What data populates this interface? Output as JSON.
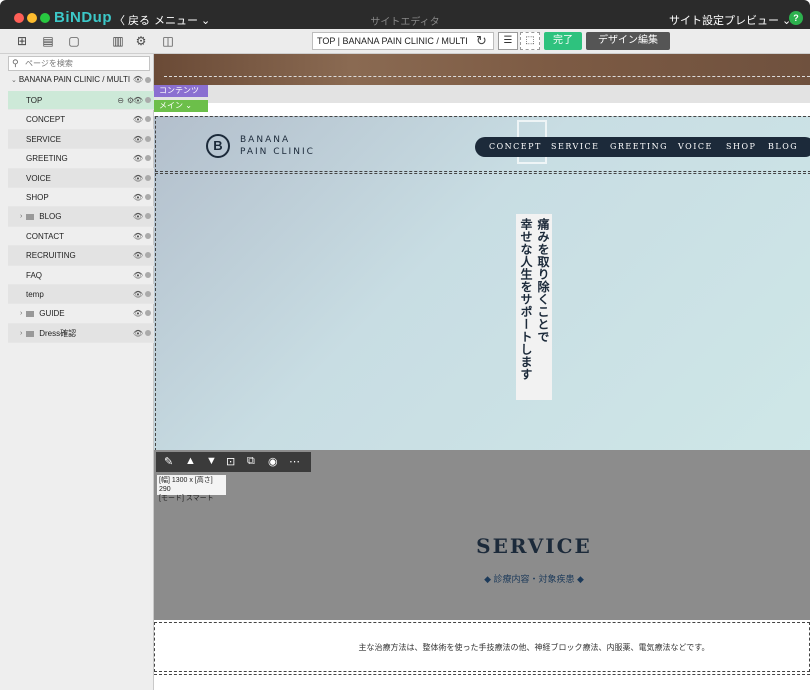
{
  "titlebar": {
    "logo": "BiNDup",
    "back": "〈 戻る",
    "menu": "メニュー ⌄",
    "title": "サイトエディタ",
    "site_settings": "サイト設定",
    "preview": "プレビュー ⌄",
    "help_icon": "help-icon"
  },
  "toolbar": {
    "url": "TOP | BANANA PAIN CLINIC / MULTI",
    "done_label": "完了",
    "design_label": "デザイン編集"
  },
  "sidebar": {
    "search_placeholder": "ページを検索",
    "root_label": "BANANA PAIN CLINIC / MULTI",
    "items": [
      {
        "label": "TOP"
      },
      {
        "label": "CONCEPT"
      },
      {
        "label": "SERVICE"
      },
      {
        "label": "GREETING"
      },
      {
        "label": "VOICE"
      },
      {
        "label": "SHOP"
      },
      {
        "label": "BLOG"
      },
      {
        "label": "CONTACT"
      },
      {
        "label": "RECRUITING"
      },
      {
        "label": "FAQ"
      },
      {
        "label": "temp"
      },
      {
        "label": "GUIDE"
      },
      {
        "label": "Dress確認"
      }
    ]
  },
  "canvas": {
    "tag_contents": "コンテンツ",
    "tag_main": "メイン ⌄",
    "brand_line1": "BANANA",
    "brand_line2": "PAIN CLINIC",
    "nav": [
      "CONCEPT",
      "SERVICE",
      "GREETING",
      "VOICE",
      "SHOP",
      "BLOG"
    ],
    "hero_col1": "痛みを取り除くことで",
    "hero_col2": "幸せな人生をサポートします",
    "size_line1": "[幅] 1300 x [高さ] 290",
    "size_line2": "[モード] スマート",
    "service_title": "SERVICE",
    "service_sub": "◆  診療内容・対象疾患  ◆",
    "service_text": "主な治療方法は、整体術を使った手技療法の他、神経ブロック療法、内服薬、電気療法などです。"
  },
  "colors": {
    "accent": "#3cc8c8",
    "done": "#2ec27e",
    "selected_row": "#cde9d8",
    "tag_contents": "#8a6fd1",
    "tag_main": "#6cbf4a",
    "navy": "#1c2a3a"
  }
}
